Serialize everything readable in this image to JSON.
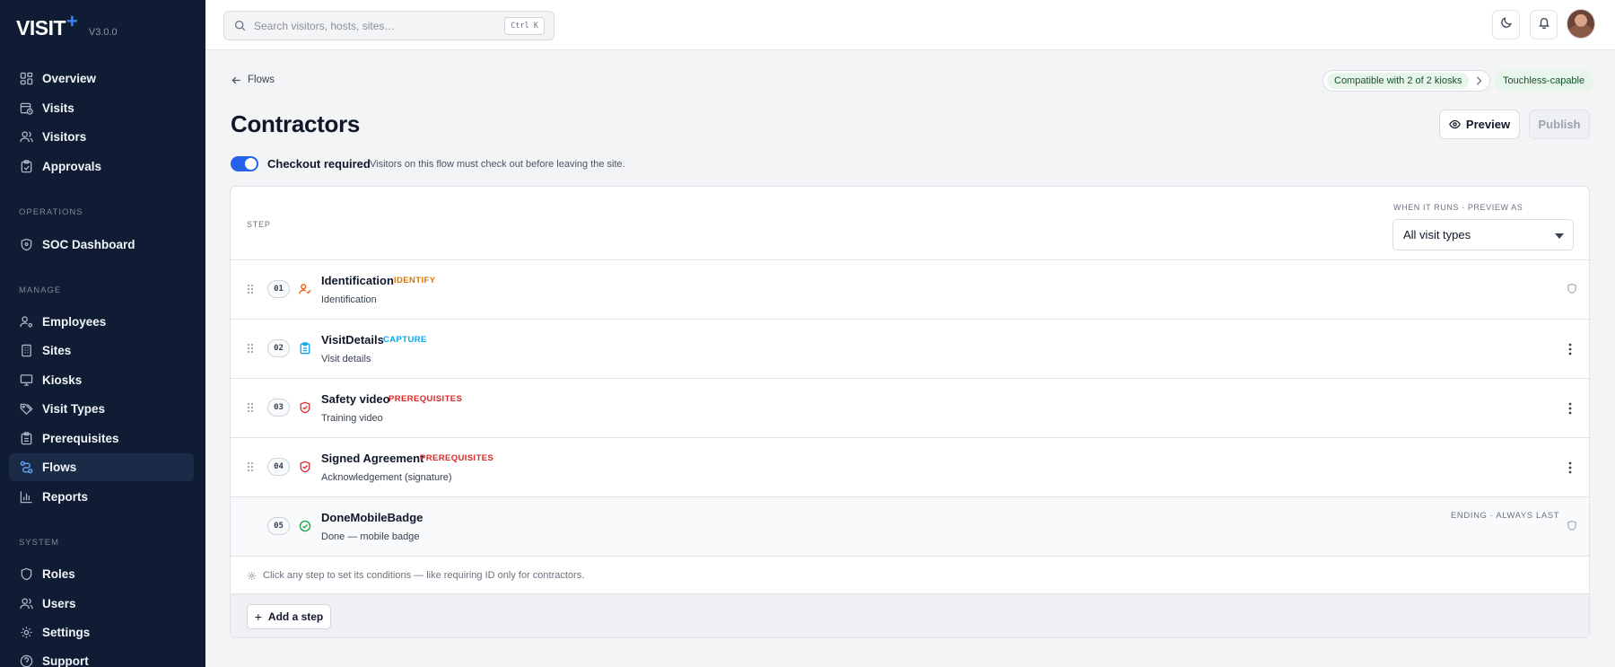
{
  "brand": {
    "name": "VISIT",
    "plus": "+",
    "version": "V3.0.0"
  },
  "sidebar": {
    "top_items": [
      {
        "label": "Overview",
        "icon": "grid-icon"
      },
      {
        "label": "Visits",
        "icon": "calendar-clock-icon"
      },
      {
        "label": "Visitors",
        "icon": "users-icon"
      },
      {
        "label": "Approvals",
        "icon": "clipboard-check-icon"
      }
    ],
    "sections": {
      "operations": "OPERATIONS",
      "manage": "MANAGE",
      "system": "SYSTEM"
    },
    "operations_items": [
      {
        "label": "SOC Dashboard",
        "icon": "shield-icon"
      }
    ],
    "manage_items": [
      {
        "label": "Employees",
        "icon": "user-cog-icon"
      },
      {
        "label": "Sites",
        "icon": "building-icon"
      },
      {
        "label": "Kiosks",
        "icon": "monitor-icon"
      },
      {
        "label": "Visit Types",
        "icon": "tags-icon"
      },
      {
        "label": "Prerequisites",
        "icon": "clipboard-list-icon"
      },
      {
        "label": "Flows",
        "icon": "workflow-icon",
        "active": true
      },
      {
        "label": "Reports",
        "icon": "bar-chart-icon"
      }
    ],
    "system_items": [
      {
        "label": "Roles",
        "icon": "shield-check-icon"
      },
      {
        "label": "Users",
        "icon": "users-icon"
      },
      {
        "label": "Settings",
        "icon": "gear-icon"
      },
      {
        "label": "Support",
        "icon": "help-circle-icon"
      }
    ]
  },
  "topbar": {
    "search_placeholder": "Search visitors, hosts, sites…",
    "shortcut": "Ctrl K"
  },
  "header": {
    "back_label": "Flows",
    "title": "Contractors",
    "compat_label": "Compatible with 2 of 2 kiosks",
    "touchless_label": "Touchless-capable",
    "preview_label": "Preview",
    "publish_label": "Publish"
  },
  "checkout": {
    "label": "Checkout required",
    "description": "Visitors on this flow must check out before leaving the site.",
    "enabled": true
  },
  "table": {
    "col_step": "STEP",
    "col_when": "WHEN IT RUNS · PREVIEW AS",
    "preview_as": "All visit types",
    "steps": [
      {
        "num": "01",
        "name": "Identification",
        "tag": "IDENTIFY",
        "tag_color": "#d97706",
        "sub": "Identification",
        "icon": "user-check-icon",
        "icon_color": "#ea580c"
      },
      {
        "num": "02",
        "name": "VisitDetails",
        "tag": "CAPTURE",
        "tag_color": "#0ea5e9",
        "sub": "Visit details",
        "icon": "clipboard-icon",
        "icon_color": "#0ea5e9"
      },
      {
        "num": "03",
        "name": "Safety video",
        "tag": "PREREQUISITES",
        "tag_color": "#dc2626",
        "sub": "Training video",
        "icon": "shield-check-icon",
        "icon_color": "#dc2626"
      },
      {
        "num": "04",
        "name": "Signed Agreement",
        "tag": "PREREQUISITES",
        "tag_color": "#dc2626",
        "sub": "Acknowledgement (signature)",
        "icon": "shield-check-icon",
        "icon_color": "#dc2626"
      },
      {
        "num": "05",
        "name": "DoneMobileBadge",
        "tag": "",
        "sub": "Done — mobile badge",
        "icon": "check-circle-icon",
        "icon_color": "#16a34a",
        "ending": "ENDING · ALWAYS LAST"
      }
    ],
    "hint": "Click any step to set its conditions — like requiring ID only for contractors.",
    "add_step": "Add a step"
  }
}
